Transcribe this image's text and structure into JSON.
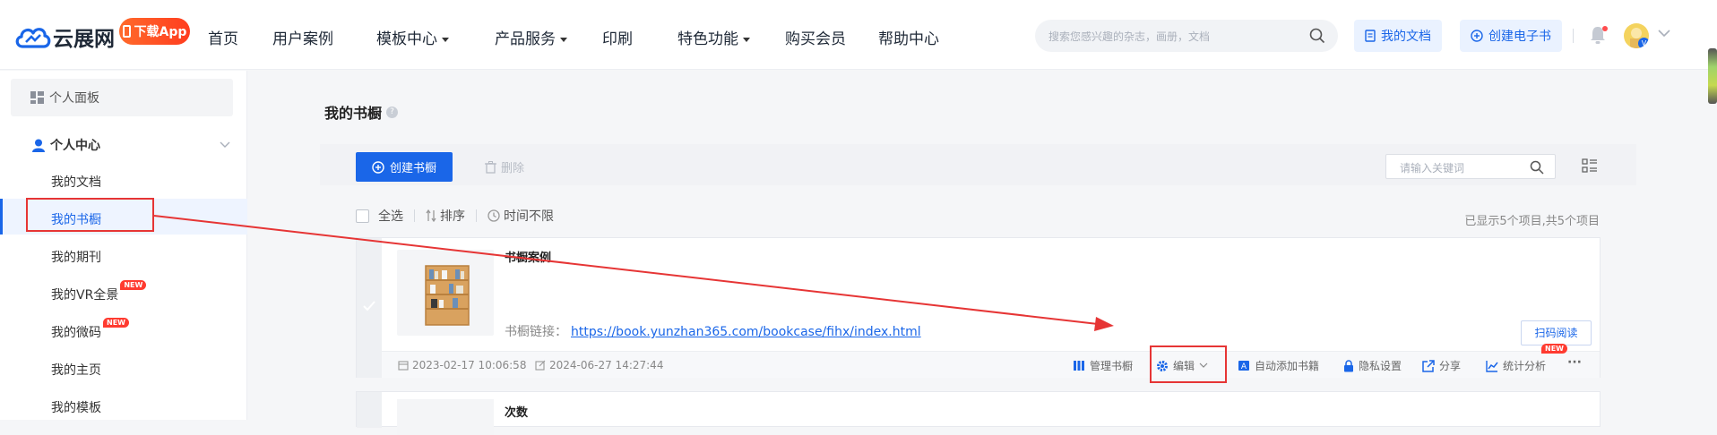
{
  "header": {
    "logo_text": "云展网",
    "app_badge": "下载App",
    "nav": [
      {
        "label": "首页",
        "dropdown": false
      },
      {
        "label": "用户案例",
        "dropdown": false
      },
      {
        "label": "模板中心",
        "dropdown": true
      },
      {
        "label": "产品服务",
        "dropdown": true
      },
      {
        "label": "印刷",
        "dropdown": false
      },
      {
        "label": "特色功能",
        "dropdown": true
      },
      {
        "label": "购买会员",
        "dropdown": false
      },
      {
        "label": "帮助中心",
        "dropdown": false
      }
    ],
    "search_placeholder": "搜索您感兴趣的杂志，画册，文档",
    "my_docs_label": "我的文档",
    "create_ebook_label": "创建电子书"
  },
  "sidebar": {
    "panel_label": "个人面板",
    "section_title": "个人中心",
    "items": [
      {
        "label": "我的文档",
        "badge": ""
      },
      {
        "label": "我的书橱",
        "badge": ""
      },
      {
        "label": "我的期刊",
        "badge": ""
      },
      {
        "label": "我的VR全景",
        "badge": "NEW"
      },
      {
        "label": "我的微码",
        "badge": "NEW"
      },
      {
        "label": "我的主页",
        "badge": ""
      },
      {
        "label": "我的模板",
        "badge": ""
      }
    ],
    "active_index": 1
  },
  "main": {
    "title": "我的书橱",
    "create_label": "创建书橱",
    "delete_label": "删除",
    "keyword_placeholder": "请输入关键词",
    "select_all_label": "全选",
    "sort_label": "排序",
    "time_label": "时间不限",
    "count_text": "已显示5个项目,共5个项目",
    "items": [
      {
        "title": "书橱案例",
        "link_label": "书橱链接：",
        "link_url": "https://book.yunzhan365.com/bookcase/fihx/index.html",
        "scan_label": "扫码阅读",
        "created": "2023-02-17 10:06:58",
        "updated": "2024-06-27 14:27:44",
        "actions": {
          "manage": "管理书橱",
          "edit": "编辑",
          "auto_add": "自动添加书籍",
          "privacy": "隐私设置",
          "share": "分享",
          "stats": "统计分析",
          "stats_badge": "NEW",
          "more": "···"
        }
      },
      {
        "title": "次数"
      }
    ]
  },
  "colors": {
    "accent": "#1a66e8",
    "annotation": "#e63535",
    "badge": "#ff3b30"
  }
}
